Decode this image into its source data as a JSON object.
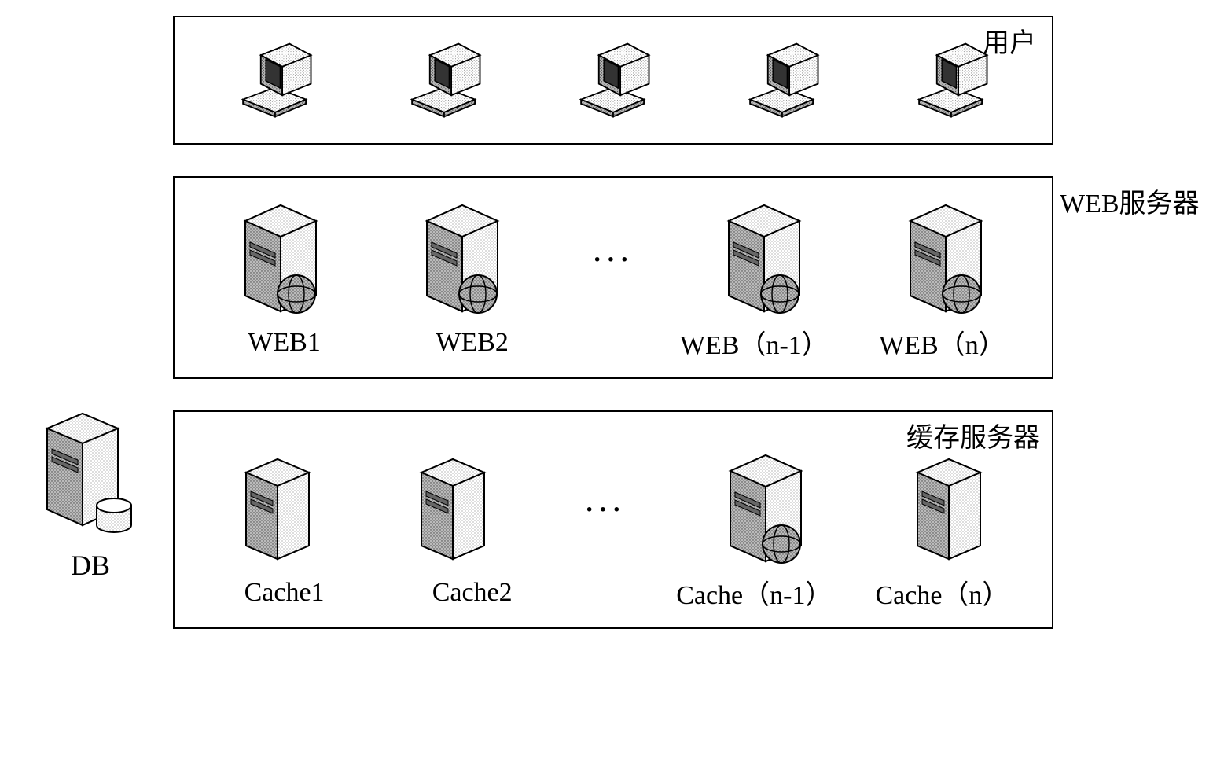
{
  "layers": {
    "user": {
      "label": "用户"
    },
    "web": {
      "label": "WEB服务器",
      "items": [
        "WEB1",
        "WEB2",
        "WEB（n-1）",
        "WEB（n）"
      ]
    },
    "cache": {
      "label": "缓存服务器",
      "items": [
        "Cache1",
        "Cache2",
        "Cache（n-1）",
        "Cache（n）"
      ]
    }
  },
  "db": {
    "label": "DB"
  },
  "ellipsis": "···"
}
